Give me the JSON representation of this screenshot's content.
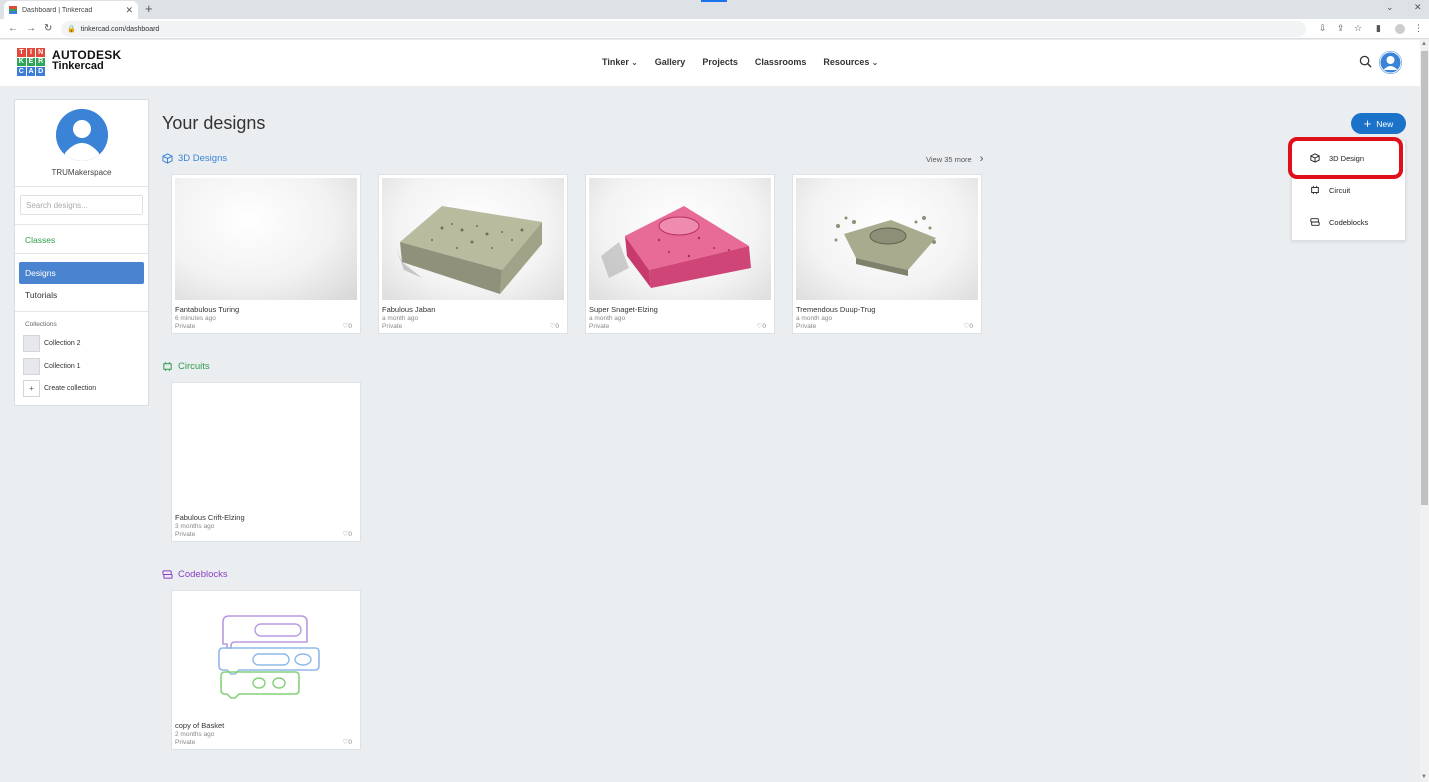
{
  "browser": {
    "tab_title": "Dashboard | Tinkercad",
    "url": "tinkercad.com/dashboard"
  },
  "header": {
    "logo_letters": [
      "T",
      "I",
      "N",
      "K",
      "E",
      "R",
      "C",
      "A",
      "D"
    ],
    "logo_colors": [
      "#e2483b",
      "#e2483b",
      "#e2483b",
      "#2ea657",
      "#2ea657",
      "#2ea657",
      "#3b7dd8",
      "#3b7dd8",
      "#3b7dd8"
    ],
    "brand_line1": "AUTODESK",
    "brand_line2": "Tinkercad",
    "nav": [
      {
        "label": "Tinker",
        "has_dropdown": true
      },
      {
        "label": "Gallery",
        "has_dropdown": false
      },
      {
        "label": "Projects",
        "has_dropdown": false
      },
      {
        "label": "Classrooms",
        "has_dropdown": false
      },
      {
        "label": "Resources",
        "has_dropdown": true
      }
    ]
  },
  "sidebar": {
    "username": "TRUMakerspace",
    "search_placeholder": "Search designs...",
    "classes_label": "Classes",
    "designs_label": "Designs",
    "tutorials_label": "Tutorials",
    "collections_heading": "Collections",
    "collections": [
      "Collection 2",
      "Collection 1"
    ],
    "create_collection": "Create collection"
  },
  "main": {
    "page_title": "Your designs",
    "sections": {
      "designs3d": {
        "label": "3D Designs",
        "view_more": "View 35 more",
        "cards": [
          {
            "name": "Fantabulous Turing",
            "time": "6 minutes ago",
            "privacy": "Private",
            "likes": "0"
          },
          {
            "name": "Fabulous Jaban",
            "time": "a month ago",
            "privacy": "Private",
            "likes": "0"
          },
          {
            "name": "Super Snaget-Elzing",
            "time": "a month ago",
            "privacy": "Private",
            "likes": "0"
          },
          {
            "name": "Tremendous Duup-Trug",
            "time": "a month ago",
            "privacy": "Private",
            "likes": "0"
          }
        ]
      },
      "circuits": {
        "label": "Circuits",
        "cards": [
          {
            "name": "Fabulous Crift-Elzing",
            "time": "3 months ago",
            "privacy": "Private",
            "likes": "0"
          }
        ]
      },
      "codeblocks": {
        "label": "Codeblocks",
        "cards": [
          {
            "name": "copy of Basket",
            "time": "2 months ago",
            "privacy": "Private",
            "likes": "0"
          }
        ]
      }
    }
  },
  "new_menu": {
    "button_label": "New",
    "items": [
      "3D Design",
      "Circuit",
      "Codeblocks"
    ],
    "highlighted_item": "3D Design"
  },
  "colors": {
    "accent_blue": "#1b72c9",
    "designs_blue": "#3b83d6",
    "circuits_green": "#2e9b4d",
    "codeblocks_purple": "#8a3fc4",
    "highlight_red": "#e0101a",
    "model_olive": "#a9ab8e",
    "model_pink": "#e04a80"
  }
}
